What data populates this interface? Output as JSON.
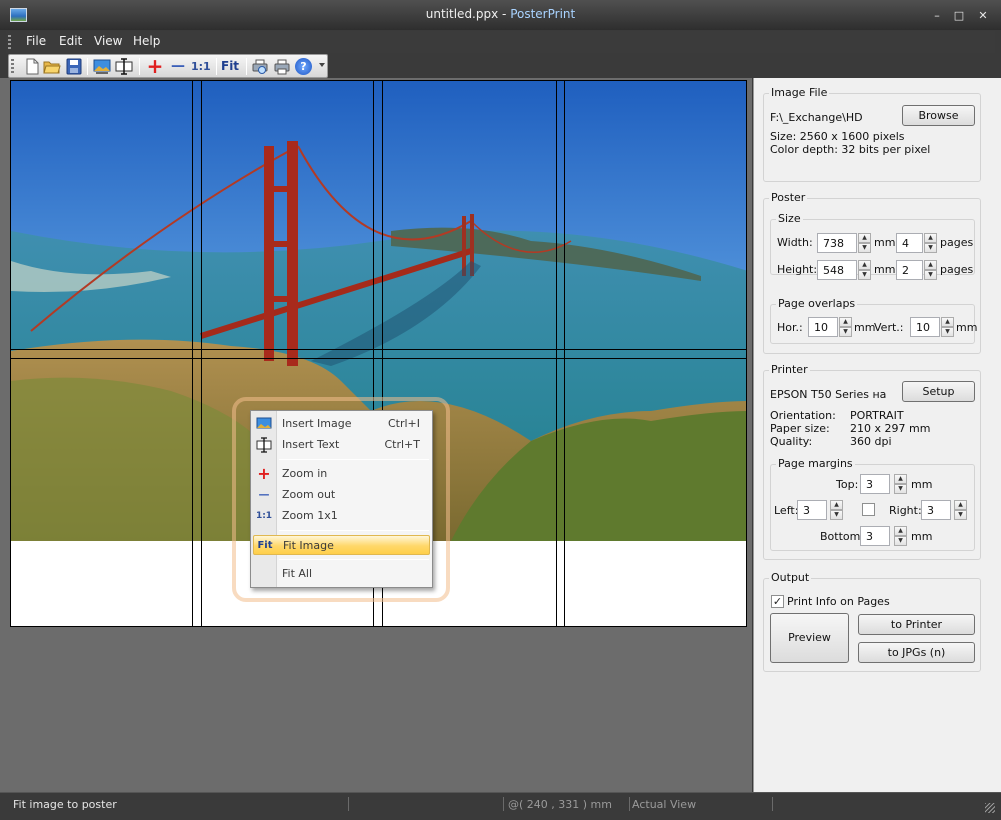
{
  "window": {
    "file_name": "untitled.ppx",
    "title_separator": " - ",
    "app_name": "PosterPrint",
    "minimize": "–",
    "maximize": "□",
    "close": "✕"
  },
  "menu": [
    "File",
    "Edit",
    "View",
    "Help"
  ],
  "toolbar": {
    "buttons": [
      "new-document-icon",
      "open-folder-icon",
      "save-icon",
      "insert-image-icon",
      "insert-text-icon",
      "zoom-in-icon",
      "zoom-out-icon",
      "zoom-1x1-icon",
      "fit-icon",
      "print-preview-icon",
      "print-icon",
      "help-icon"
    ],
    "zoom_1x1_label": "1:1",
    "fit_label": "Fit",
    "zoom_in_glyph": "+",
    "zoom_out_glyph": "—",
    "help_glyph": "?"
  },
  "context_menu": {
    "items": [
      {
        "label": "Insert Image",
        "shortcut": "Ctrl+I"
      },
      {
        "label": "Insert Text",
        "shortcut": "Ctrl+T"
      },
      {
        "label": "Zoom in",
        "shortcut": ""
      },
      {
        "label": "Zoom out",
        "shortcut": ""
      },
      {
        "label": "Zoom 1x1",
        "shortcut": ""
      },
      {
        "label": "Fit Image",
        "shortcut": ""
      },
      {
        "label": "Fit All",
        "shortcut": ""
      }
    ],
    "highlighted": "Fit Image",
    "icons": {
      "zoom_in": "+",
      "zoom_out": "—",
      "zoom_1x1": "1:1",
      "fit": "Fit"
    }
  },
  "image_file": {
    "group_title": "Image File",
    "path": "F:\\_Exchange\\HD",
    "browse_label": "Browse",
    "size": "Size: 2560 x 1600 pixels",
    "color_depth": "Color depth: 32 bits per pixel"
  },
  "poster": {
    "group_title": "Poster",
    "size_title": "Size",
    "width_label": "Width:",
    "width_value": "738",
    "width_unit": "mm",
    "width_pages": "4",
    "height_label": "Height:",
    "height_value": "548",
    "height_unit": "mm",
    "height_pages": "2",
    "pages_label": "pages",
    "overlaps_title": "Page overlaps",
    "hor_label": "Hor.:",
    "hor_value": "10",
    "hor_unit": "mm",
    "vert_label": "Vert.:",
    "vert_value": "10",
    "vert_unit": "mm"
  },
  "printer": {
    "group_title": "Printer",
    "name": "EPSON T50 Series на",
    "setup_label": "Setup",
    "orientation_label": "Orientation:",
    "orientation_value": "PORTRAIT",
    "paper_label": "Paper size:",
    "paper_value": "210 x 297 mm",
    "quality_label": "Quality:",
    "quality_value": "360 dpi",
    "margins_title": "Page margins",
    "top_label": "Top:",
    "top_value": "3",
    "top_unit": "mm",
    "left_label": "Left:",
    "left_value": "3",
    "right_label": "Right:",
    "right_value": "3",
    "bottom_label": "Bottom:",
    "bottom_value": "3",
    "bottom_unit": "mm",
    "margin_checkbox_checked": false
  },
  "output": {
    "group_title": "Output",
    "print_info_label": "Print Info on Pages",
    "print_info_checked": true,
    "preview_label": "Preview",
    "to_printer_label": "to Printer",
    "to_jpgs_label": "to JPGs (n)"
  },
  "statusbar": {
    "message": "Fit image to poster",
    "position": "@( 240 , 331 ) mm",
    "view": "Actual View"
  },
  "spin_glyphs": {
    "up": "▲",
    "down": "▼"
  },
  "colors": {
    "accent_highlight": "#ffd86a",
    "app_title": "#a9d3ff",
    "window_chrome": "#3a3a3a",
    "workspace": "#6c6c6c",
    "panel": "#f0f0f0"
  }
}
